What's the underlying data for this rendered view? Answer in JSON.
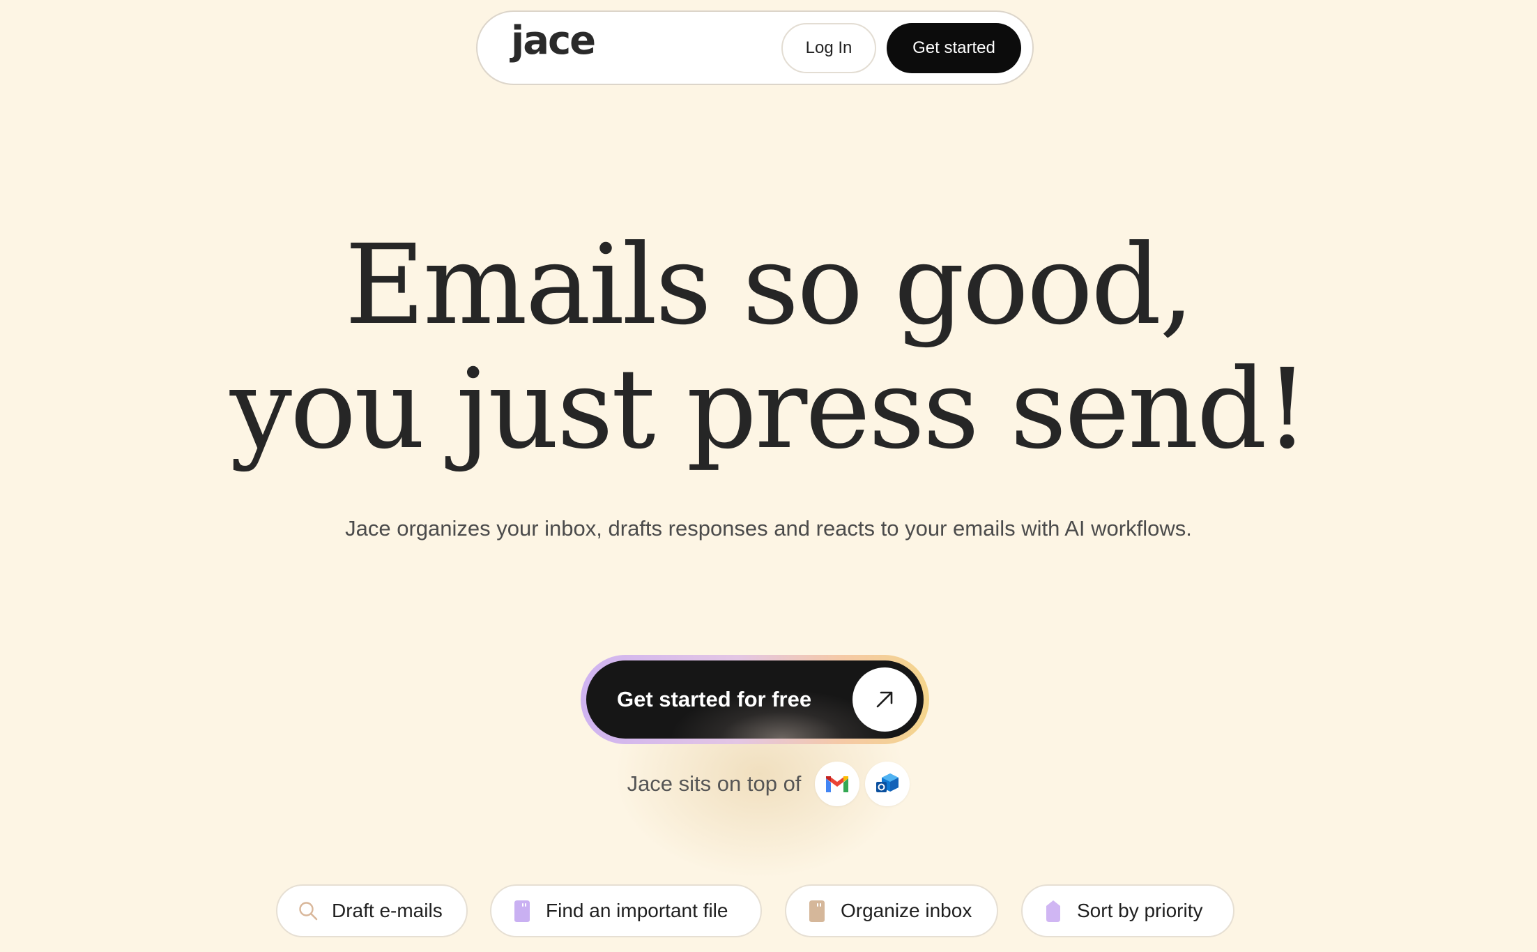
{
  "nav": {
    "logo": "jace",
    "login_label": "Log In",
    "cta_label": "Get started"
  },
  "hero": {
    "headline_line1": "Emails so good,",
    "headline_line2": "you just press send!",
    "subtitle": "Jace organizes your inbox, drafts responses and reacts to your emails with AI workflows.",
    "cta_label": "Get started for free",
    "cta_icon": "arrow-up-right-icon",
    "sits_on_top_text": "Jace sits on top of",
    "integrations": [
      {
        "name": "Gmail",
        "icon": "gmail-icon"
      },
      {
        "name": "Outlook",
        "icon": "outlook-icon"
      }
    ]
  },
  "chips": [
    {
      "label": "Draft e-mails",
      "icon": "search-icon",
      "icon_color": "#d9b79a"
    },
    {
      "label": "Find an important file",
      "icon": "file-icon",
      "icon_color": "#c9b0f2"
    },
    {
      "label": "Organize inbox",
      "icon": "file-icon",
      "icon_color": "#d5b79a"
    },
    {
      "label": "Sort by priority",
      "icon": "tag-icon",
      "icon_color": "#d0b6f3"
    }
  ],
  "colors": {
    "background": "#fdf5e4",
    "text_dark": "#262626",
    "button_dark": "#0c0c0c",
    "ring_gradient": [
      "#cfb3f0",
      "#f5c9a6",
      "#f4d58c"
    ]
  }
}
